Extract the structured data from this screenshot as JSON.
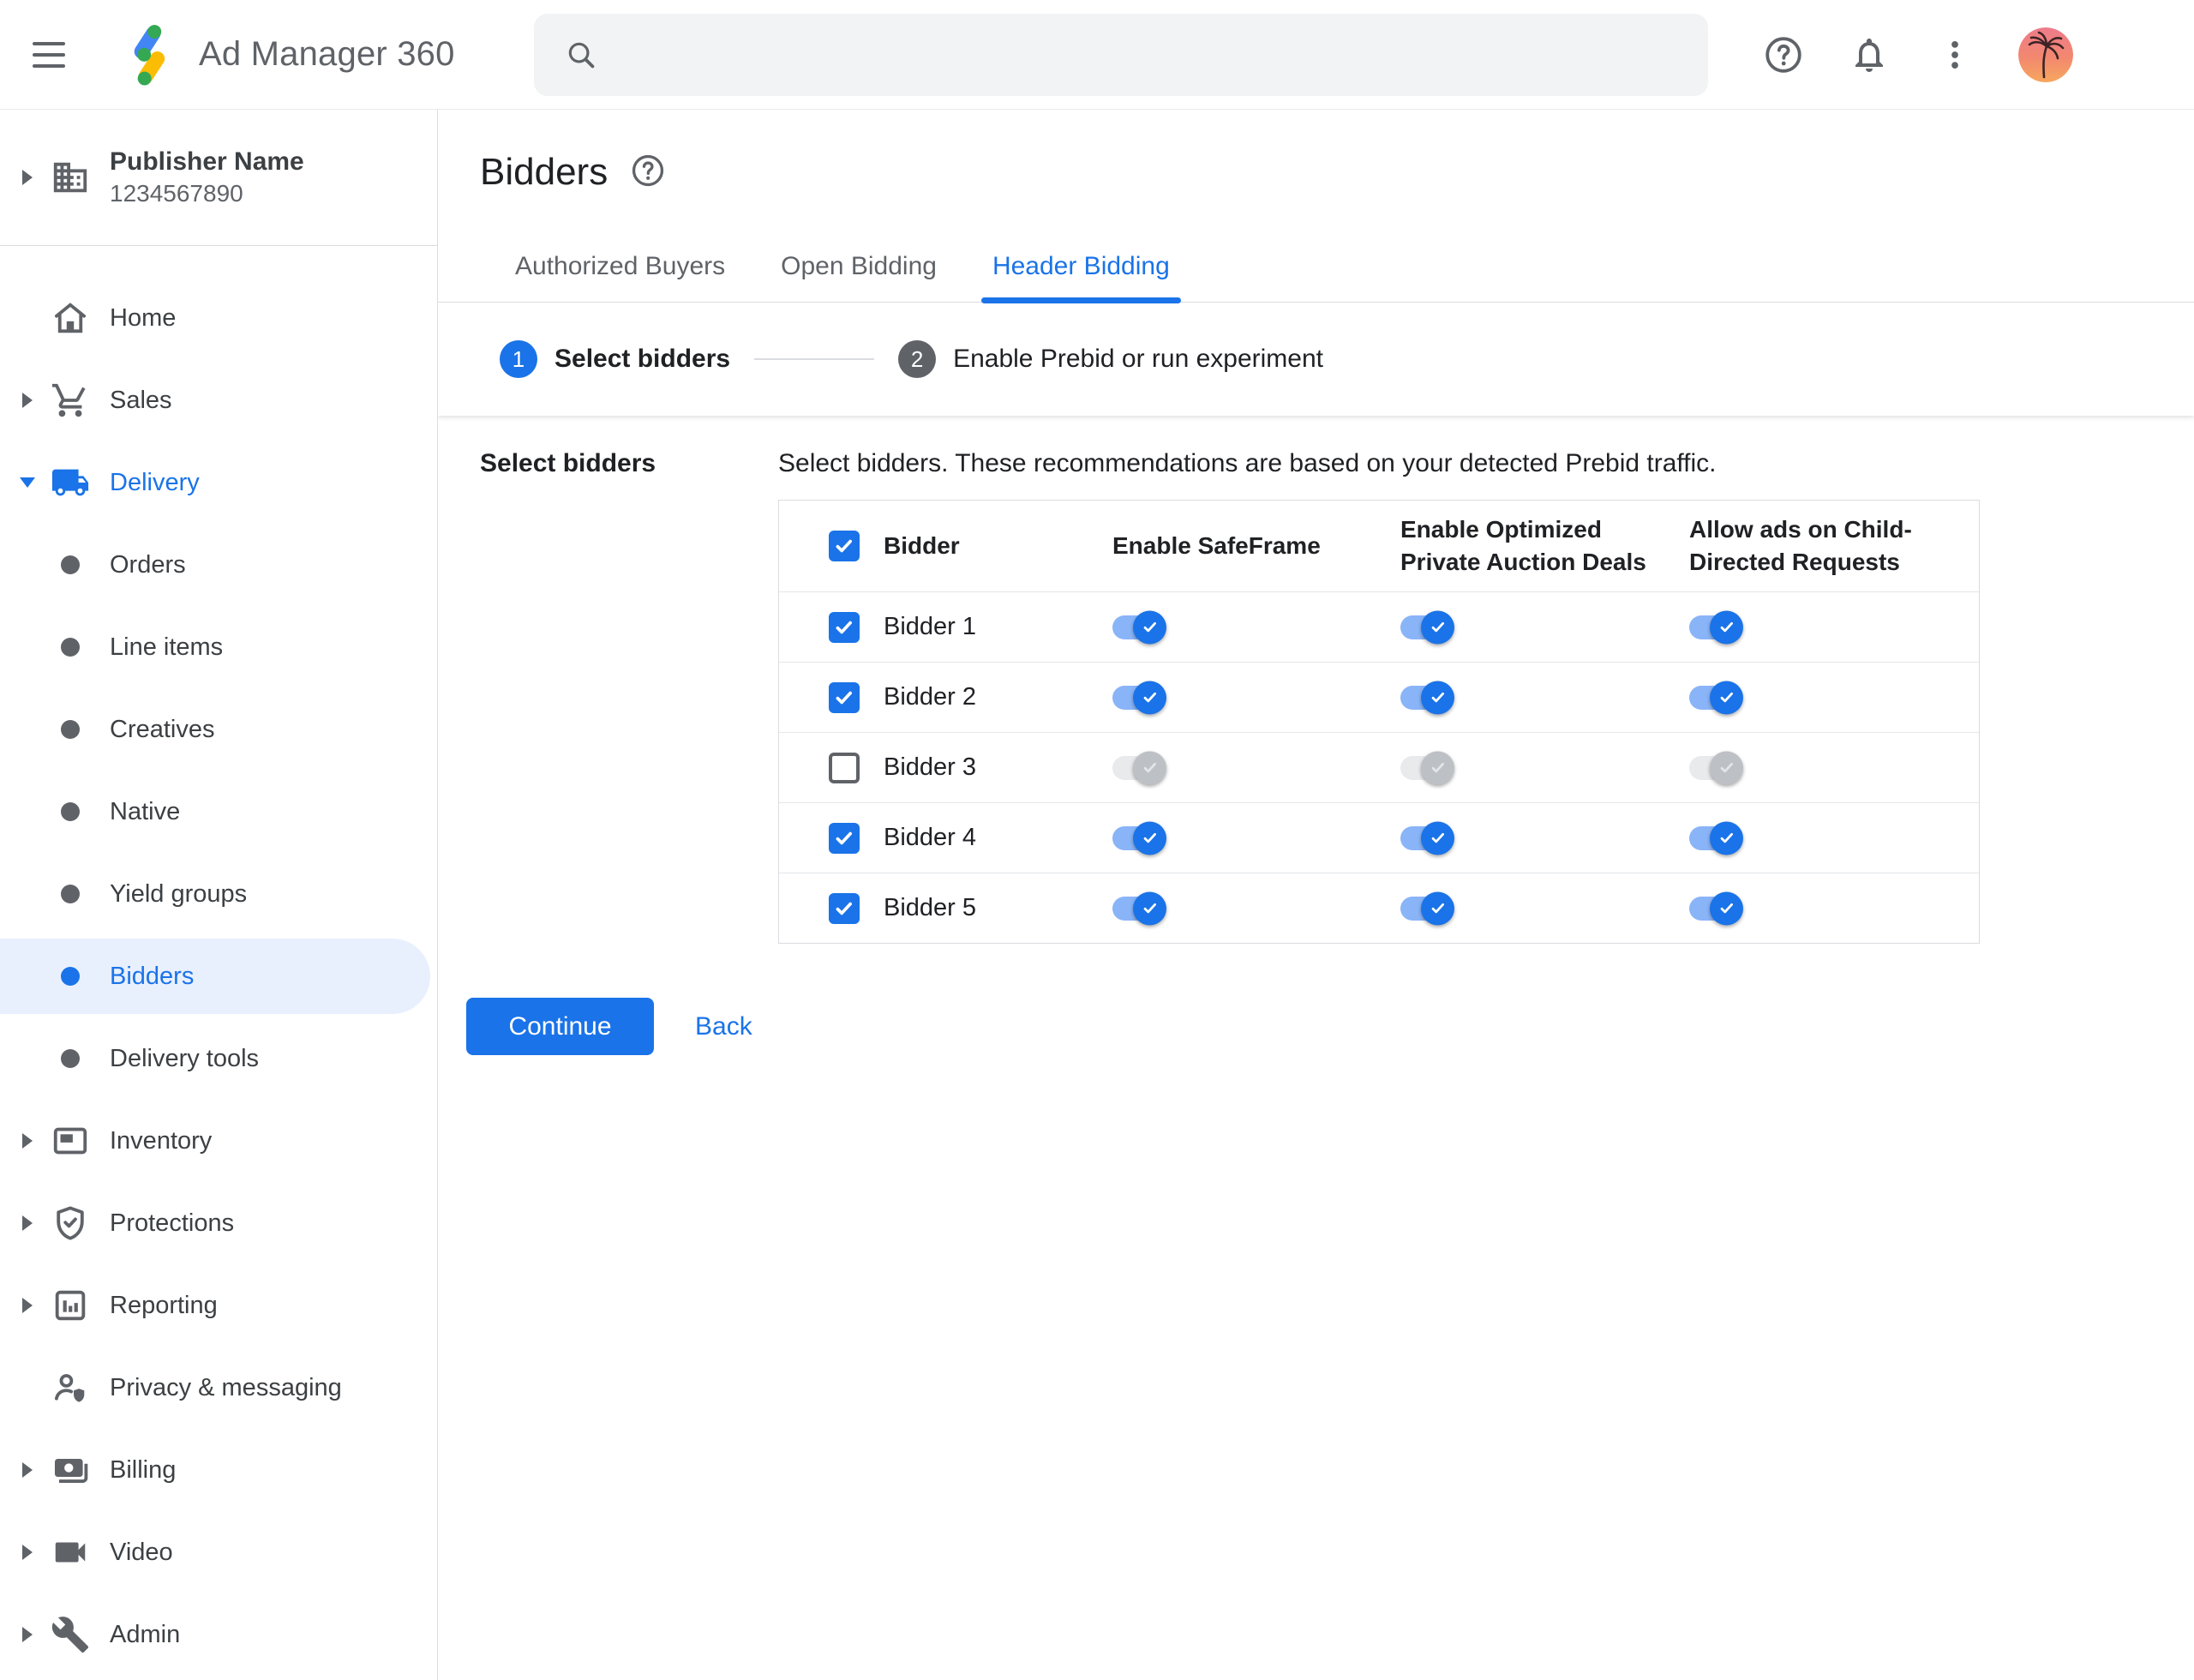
{
  "colors": {
    "accent": "#1a73e8",
    "toggle_track_on": "#8ab4f8",
    "toggle_knob_disabled": "#bdc1c6",
    "selected_item_bg": "#e8f0fe",
    "text_primary": "#202124",
    "text_secondary": "#5f6368",
    "border": "#dadce0",
    "search_bg": "#f1f3f4",
    "step_inactive": "#5f6368",
    "logo_blue": "#4285f4",
    "logo_yellow": "#fbbc04",
    "logo_green": "#34a853"
  },
  "app_bar": {
    "title": "Ad Manager 360",
    "search_placeholder": "",
    "icons": [
      "menu-icon",
      "ad-manager-logo",
      "search-icon",
      "help-icon",
      "notifications-icon",
      "more-vert-icon",
      "avatar"
    ]
  },
  "sidebar": {
    "publisher": {
      "name": "Publisher Name",
      "id": "1234567890"
    },
    "items": [
      {
        "label": "Home",
        "icon": "home-icon",
        "type": "top",
        "caret": "none"
      },
      {
        "label": "Sales",
        "icon": "shopping-cart-icon",
        "type": "top",
        "caret": "right"
      },
      {
        "label": "Delivery",
        "icon": "delivery-truck-icon",
        "type": "top",
        "caret": "down",
        "expanded": true,
        "highlighted": true
      },
      {
        "label": "Orders",
        "type": "sub"
      },
      {
        "label": "Line items",
        "type": "sub"
      },
      {
        "label": "Creatives",
        "type": "sub"
      },
      {
        "label": "Native",
        "type": "sub"
      },
      {
        "label": "Yield groups",
        "type": "sub"
      },
      {
        "label": "Bidders",
        "type": "sub",
        "selected": true
      },
      {
        "label": "Delivery tools",
        "type": "sub"
      },
      {
        "label": "Inventory",
        "icon": "inventory-icon",
        "type": "top",
        "caret": "right"
      },
      {
        "label": "Protections",
        "icon": "shield-check-icon",
        "type": "top",
        "caret": "right"
      },
      {
        "label": "Reporting",
        "icon": "bar-chart-icon",
        "type": "top",
        "caret": "right"
      },
      {
        "label": "Privacy & messaging",
        "icon": "person-shield-icon",
        "type": "top",
        "caret": "none"
      },
      {
        "label": "Billing",
        "icon": "payments-icon",
        "type": "top",
        "caret": "right"
      },
      {
        "label": "Video",
        "icon": "video-camera-icon",
        "type": "top",
        "caret": "right"
      },
      {
        "label": "Admin",
        "icon": "wrench-icon",
        "type": "top",
        "caret": "right"
      }
    ]
  },
  "main": {
    "page_title": "Bidders",
    "tabs": [
      {
        "label": "Authorized Buyers",
        "active": false
      },
      {
        "label": "Open Bidding",
        "active": false
      },
      {
        "label": "Header Bidding",
        "active": true
      }
    ],
    "stepper": {
      "steps": [
        {
          "number": "1",
          "label": "Select bidders",
          "active": true
        },
        {
          "number": "2",
          "label": "Enable Prebid or run experiment",
          "active": false
        }
      ]
    },
    "section_label": "Select bidders",
    "description": "Select bidders. These recommendations are based on your detected Prebid traffic.",
    "table": {
      "select_all_checked": true,
      "columns": [
        "Bidder",
        "Enable SafeFrame",
        "Enable Optimized Private Auction Deals",
        "Allow ads on Child-Directed Requests"
      ],
      "rows": [
        {
          "name": "Bidder 1",
          "checked": true,
          "toggles": [
            true,
            true,
            true
          ]
        },
        {
          "name": "Bidder 2",
          "checked": true,
          "toggles": [
            true,
            true,
            true
          ]
        },
        {
          "name": "Bidder 3",
          "checked": false,
          "toggles": [
            false,
            false,
            false
          ]
        },
        {
          "name": "Bidder 4",
          "checked": true,
          "toggles": [
            true,
            true,
            true
          ]
        },
        {
          "name": "Bidder 5",
          "checked": true,
          "toggles": [
            true,
            true,
            true
          ]
        }
      ]
    },
    "actions": {
      "continue_label": "Continue",
      "back_label": "Back"
    }
  }
}
